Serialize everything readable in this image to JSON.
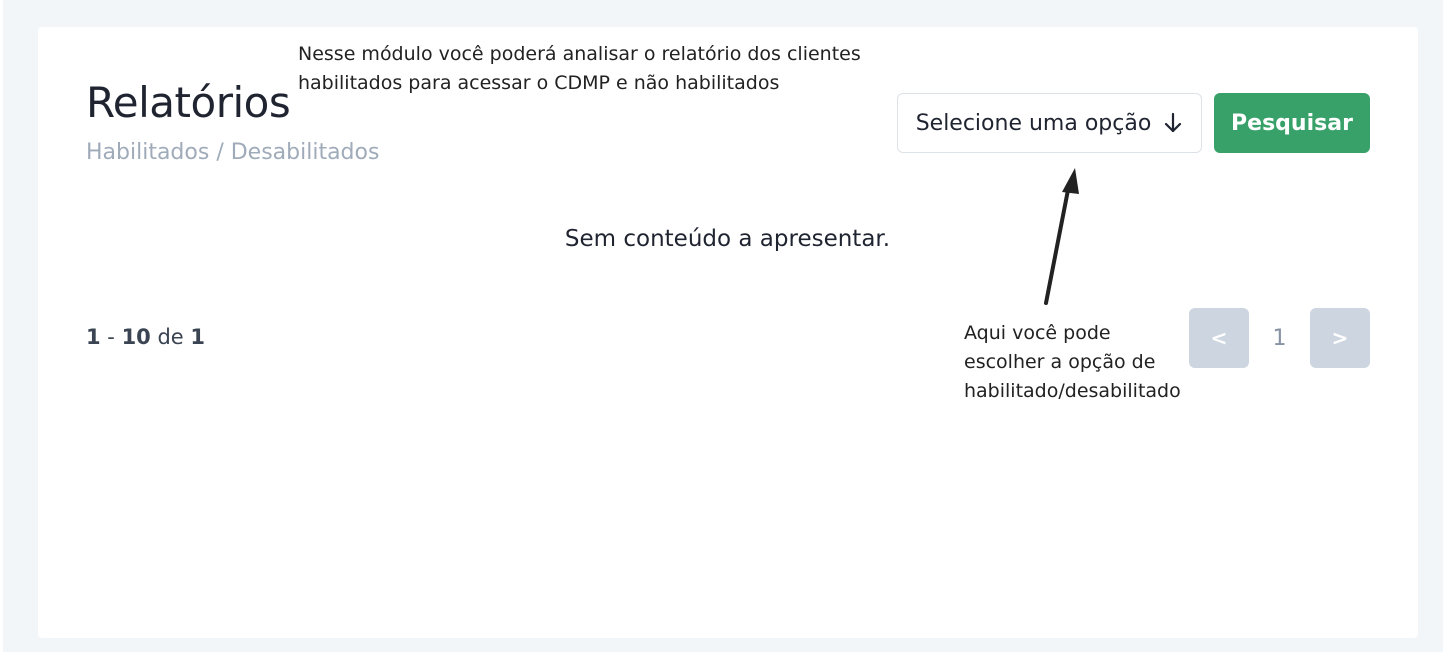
{
  "header": {
    "title": "Relatórios",
    "breadcrumb": "Habilitados / Desabilitados"
  },
  "annotations": {
    "top_line1": "Nesse módulo você poderá analisar o relatório dos clientes",
    "top_line2": "habilitados para acessar o CDMP e não habilitados",
    "bottom_line1": "Aqui você pode",
    "bottom_line2": "escolher a opção de",
    "bottom_line3": "habilitado/desabilitado"
  },
  "filter": {
    "select_label": "Selecione uma opção",
    "select_icon": "arrow-down-icon",
    "search_label": "Pesquisar",
    "accent_color": "#38a169"
  },
  "results": {
    "empty_message": "Sem conteúdo a apresentar."
  },
  "pagination": {
    "range_start": "1",
    "range_sep": " - ",
    "range_end": "10",
    "of_label": " de ",
    "total": "1",
    "prev_label": "<",
    "current_page": "1",
    "next_label": ">"
  }
}
